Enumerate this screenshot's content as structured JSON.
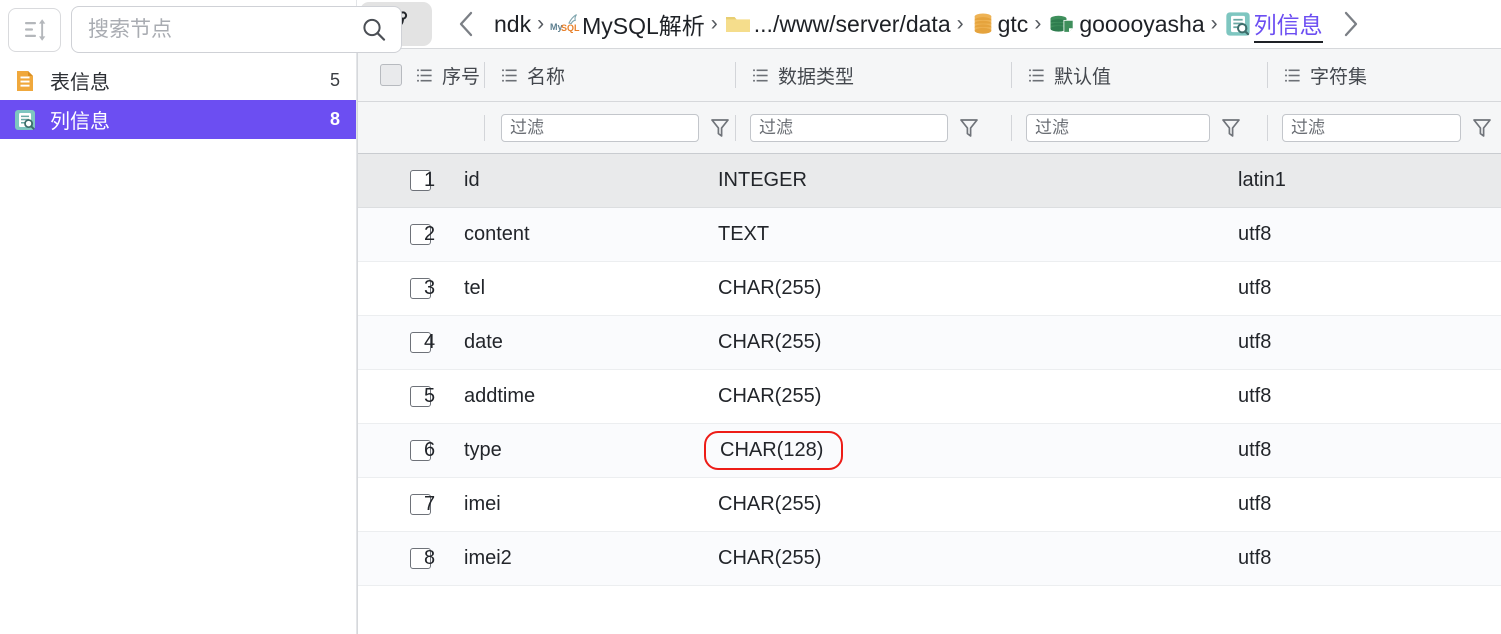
{
  "sidebar": {
    "sort_button_icon": "sort-lines-icon",
    "search": {
      "placeholder": "搜索节点",
      "value": "",
      "icon": "search-icon"
    },
    "items": [
      {
        "label": "表信息",
        "count": "5",
        "icon": "table-info-icon",
        "active": false
      },
      {
        "label": "列信息",
        "count": "8",
        "icon": "column-info-icon",
        "active": true
      }
    ]
  },
  "breadcrumb": {
    "branch_icon": "git-branch-icon",
    "back_icon": "chevron-left-icon",
    "forward_icon": "chevron-right-icon",
    "separator": "›",
    "items": [
      {
        "label": "ndk",
        "icon": ""
      },
      {
        "label": "MySQL解析",
        "icon": "mysql-icon"
      },
      {
        "label": ".../www/server/data",
        "icon": "folder-icon"
      },
      {
        "label": "gtc",
        "icon": "database-icon"
      },
      {
        "label": "gooooyasha",
        "icon": "table-icon"
      },
      {
        "label": "列信息",
        "icon": "column-info-icon",
        "current": true
      }
    ]
  },
  "table": {
    "select_all_checked": false,
    "columns": [
      {
        "key": "seq",
        "label": "序号",
        "icon": "list-icon"
      },
      {
        "key": "name",
        "label": "名称",
        "icon": "list-icon"
      },
      {
        "key": "type",
        "label": "数据类型",
        "icon": "list-icon"
      },
      {
        "key": "def",
        "label": "默认值",
        "icon": "list-icon"
      },
      {
        "key": "char",
        "label": "字符集",
        "icon": "list-icon"
      }
    ],
    "filter": {
      "placeholder": "过滤",
      "icon": "funnel-icon",
      "values": {
        "name": "",
        "type": "",
        "def": "",
        "char": ""
      }
    },
    "rows": [
      {
        "seq": "1",
        "name": "id",
        "type": "INTEGER",
        "def": "",
        "char": "latin1",
        "selected": true,
        "checked": false,
        "highlight": false
      },
      {
        "seq": "2",
        "name": "content",
        "type": "TEXT",
        "def": "",
        "char": "utf8",
        "selected": false,
        "checked": false,
        "highlight": false
      },
      {
        "seq": "3",
        "name": "tel",
        "type": "CHAR(255)",
        "def": "",
        "char": "utf8",
        "selected": false,
        "checked": false,
        "highlight": false
      },
      {
        "seq": "4",
        "name": "date",
        "type": "CHAR(255)",
        "def": "",
        "char": "utf8",
        "selected": false,
        "checked": false,
        "highlight": false
      },
      {
        "seq": "5",
        "name": "addtime",
        "type": "CHAR(255)",
        "def": "",
        "char": "utf8",
        "selected": false,
        "checked": false,
        "highlight": false
      },
      {
        "seq": "6",
        "name": "type",
        "type": "CHAR(128)",
        "def": "",
        "char": "utf8",
        "selected": false,
        "checked": false,
        "highlight": true
      },
      {
        "seq": "7",
        "name": "imei",
        "type": "CHAR(255)",
        "def": "",
        "char": "utf8",
        "selected": false,
        "checked": false,
        "highlight": false
      },
      {
        "seq": "8",
        "name": "imei2",
        "type": "CHAR(255)",
        "def": "",
        "char": "utf8",
        "selected": false,
        "checked": false,
        "highlight": false
      }
    ]
  },
  "colors": {
    "accent_purple": "#6c4ef2",
    "highlight_red": "#ed1c17",
    "selected_row": "#e9eaeb",
    "header_bg": "#f5f6f7",
    "db_orange": "#e8a33d",
    "db_green": "#2f7d4f"
  }
}
